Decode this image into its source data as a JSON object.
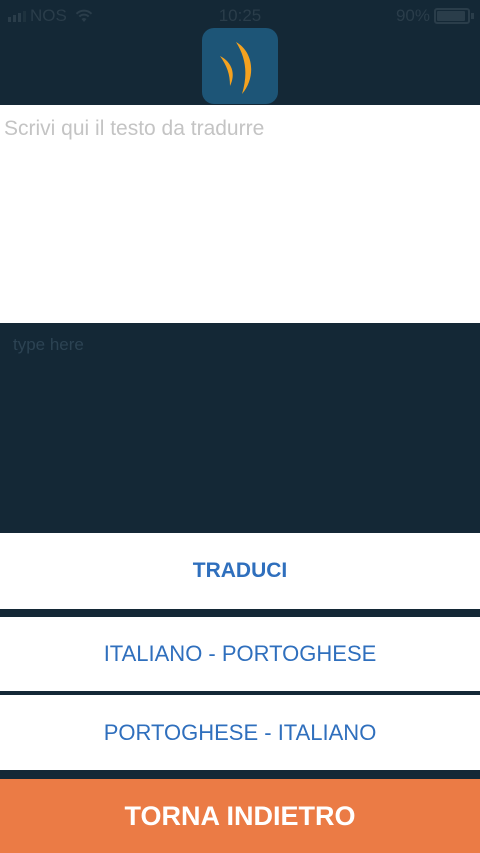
{
  "status_bar": {
    "carrier": "NOS",
    "time": "10:25",
    "battery": "90%",
    "battery_level": 0.9
  },
  "app": {
    "logo_icon": "app-logo-icon",
    "logo_bg": "#1d5577",
    "logo_accent": "#f4a21f"
  },
  "input": {
    "placeholder": "Scrivi qui il testo da tradurre",
    "value": ""
  },
  "output": {
    "placeholder": "type here",
    "value": ""
  },
  "buttons": {
    "translate": "TRADUCI",
    "italian_portuguese": "ITALIANO - PORTOGHESE",
    "portuguese_italian": "PORTOGHESE - ITALIANO",
    "back": "TORNA INDIETRO"
  },
  "colors": {
    "background": "#142836",
    "button_text": "#2f6fbd",
    "back_button": "#eb7b45"
  }
}
